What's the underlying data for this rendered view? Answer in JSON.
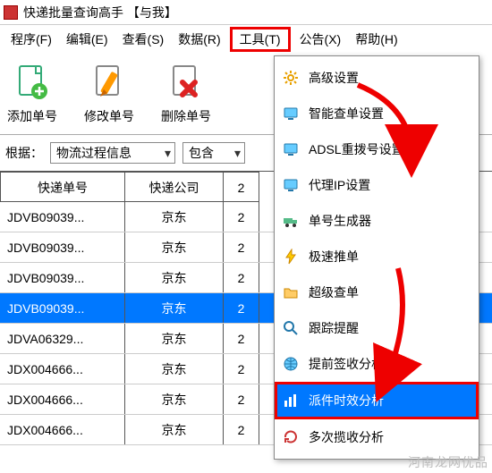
{
  "window": {
    "title": "快递批量查询高手 【与我】"
  },
  "menubar": {
    "items": [
      {
        "label": "程序(F)"
      },
      {
        "label": "编辑(E)"
      },
      {
        "label": "查看(S)"
      },
      {
        "label": "数据(R)"
      },
      {
        "label": "工具(T)",
        "highlighted": true
      },
      {
        "label": "公告(X)"
      },
      {
        "label": "帮助(H)"
      }
    ]
  },
  "toolbar": {
    "add_label": "添加单号",
    "edit_label": "修改单号",
    "delete_label": "删除单号"
  },
  "filter": {
    "basis_label": "根据：",
    "basis_value": "物流过程信息",
    "match_value": "包含"
  },
  "table": {
    "headers": {
      "c1": "快递单号",
      "c2": "快递公司",
      "c3": "2"
    },
    "rows": [
      {
        "id": "JDVB09039...",
        "company": "京东",
        "col3": "2"
      },
      {
        "id": "JDVB09039...",
        "company": "京东",
        "col3": "2"
      },
      {
        "id": "JDVB09039...",
        "company": "京东",
        "col3": "2"
      },
      {
        "id": "JDVB09039...",
        "company": "京东",
        "col3": "2",
        "selected": true
      },
      {
        "id": "JDVA06329...",
        "company": "京东",
        "col3": "2"
      },
      {
        "id": "JDX004666...",
        "company": "京东",
        "col3": "2"
      },
      {
        "id": "JDX004666...",
        "company": "京东",
        "col3": "2"
      },
      {
        "id": "JDX004666...",
        "company": "京东",
        "col3": "2"
      }
    ]
  },
  "dropdown": {
    "items": [
      {
        "icon": "gear-icon",
        "label": "高级设置"
      },
      {
        "icon": "monitor-icon",
        "label": "智能查单设置"
      },
      {
        "icon": "monitor-icon",
        "label": "ADSL重拨号设置"
      },
      {
        "icon": "monitor-icon",
        "label": "代理IP设置"
      },
      {
        "icon": "truck-icon",
        "label": "单号生成器"
      },
      {
        "icon": "bolt-icon",
        "label": "极速推单"
      },
      {
        "icon": "folder-icon",
        "label": "超级查单"
      },
      {
        "icon": "magnify-icon",
        "label": "跟踪提醒"
      },
      {
        "icon": "globe-icon",
        "label": "提前签收分析"
      },
      {
        "icon": "chart-icon",
        "label": "派件时效分析",
        "selected": true
      },
      {
        "icon": "refresh-icon",
        "label": "多次揽收分析"
      }
    ]
  },
  "watermark": "河南龙网优品"
}
